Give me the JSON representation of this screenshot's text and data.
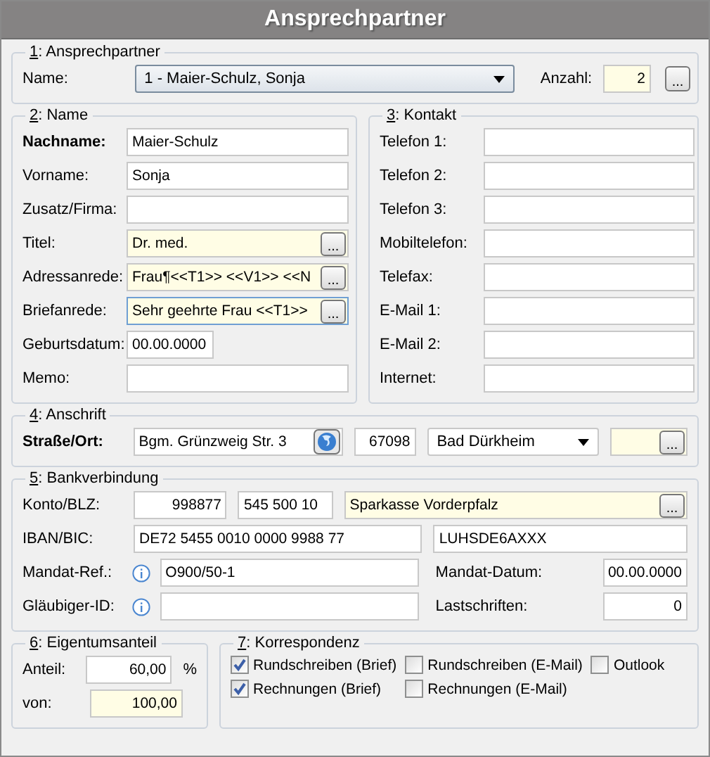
{
  "window": {
    "title": "Ansprechpartner"
  },
  "contact_person": {
    "legend": "1: Ansprechpartner",
    "name_label": "Name:",
    "name_value": "1 - Maier-Schulz, Sonja",
    "count_label": "Anzahl:",
    "count_value": "2",
    "button": "..."
  },
  "name": {
    "legend": "2: Name",
    "fields": [
      {
        "kind": "text",
        "label": "Nachname:",
        "bold": true,
        "value": "Maier-Schulz",
        "highlighted": false
      },
      {
        "kind": "text",
        "label": "Vorname:",
        "bold": false,
        "value": "Sonja",
        "highlighted": false
      },
      {
        "kind": "text",
        "label": "Zusatz/Firma:",
        "bold": false,
        "highlighted": false
      },
      {
        "kind": "lookup",
        "label": "Titel:",
        "bold": false,
        "value": "Dr. med.",
        "highlighted": true,
        "button": "..."
      },
      {
        "kind": "lookup",
        "label": "Adressanrede:",
        "bold": false,
        "value": "Frau¶<<T1>> <<V1>> <<N",
        "highlighted": true,
        "button": "..."
      },
      {
        "kind": "lookup",
        "label": "Briefanrede:",
        "bold": false,
        "value": "Sehr geehrte Frau <<T1>>",
        "highlighted": true,
        "focused": true,
        "button": "..."
      },
      {
        "kind": "date",
        "label": "Geburtsdatum:",
        "bold": false,
        "value": "00.00.0000",
        "highlighted": false
      },
      {
        "kind": "text",
        "label": "Memo:",
        "bold": false,
        "highlighted": false
      }
    ]
  },
  "contact": {
    "legend": "3: Kontakt",
    "fields": [
      {
        "label": "Telefon 1:"
      },
      {
        "label": "Telefon 2:"
      },
      {
        "label": "Telefon 3:"
      },
      {
        "label": "Mobiltelefon:"
      },
      {
        "label": "Telefax:"
      },
      {
        "label": "E-Mail 1:"
      },
      {
        "label": "E-Mail 2:"
      },
      {
        "label": "Internet:"
      }
    ]
  },
  "address": {
    "legend": "4: Anschrift",
    "label": "Straße/Ort:",
    "street": "Bgm. Grünzweig Str. 3",
    "zip": "67098",
    "city": "Bad Dürkheim",
    "button": "..."
  },
  "bank": {
    "legend": "5: Bankverbindung",
    "account_label": "Konto/BLZ:",
    "account": "998877",
    "blz": "545 500 10",
    "bank_name": "Sparkasse Vorderpfalz",
    "bank_button": "...",
    "iban_label": "IBAN/BIC:",
    "iban": "DE72 5455 0010 0000 9988 77",
    "bic": "LUHSDE6AXXX",
    "mandate_ref_label": "Mandat-Ref.:",
    "mandate_ref": "O900/50-1",
    "creditor_label": "Gläubiger-ID:",
    "mandate_date_label": "Mandat-Datum:",
    "mandate_date": "00.00.0000",
    "debits_label": "Lastschriften:",
    "debits": "0"
  },
  "share": {
    "legend": "6: Eigentumsanteil",
    "share_label": "Anteil:",
    "share": "60,00",
    "unit": "%",
    "of_label": "von:",
    "of": "100,00"
  },
  "correspondence": {
    "legend": "7: Korrespondenz",
    "options": [
      {
        "label": "Rundschreiben (Brief)",
        "checked": true
      },
      {
        "label": "Rundschreiben (E-Mail)",
        "checked": false
      },
      {
        "label": "Outlook",
        "checked": false
      },
      {
        "label": "Rechnungen (Brief)",
        "checked": true
      },
      {
        "label": "Rechnungen (E-Mail)",
        "checked": false
      }
    ]
  }
}
